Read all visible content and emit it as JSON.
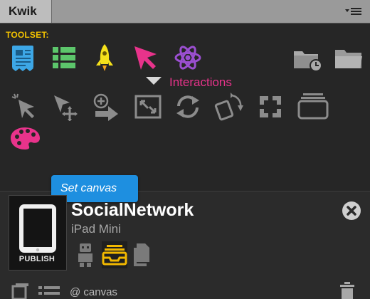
{
  "panel": {
    "tab_title": "Kwik",
    "menu_icon": "panel-menu-icon"
  },
  "toolset": {
    "label": "TOOLSET:",
    "tools": [
      {
        "name": "document-icon",
        "color": "#3da7e6"
      },
      {
        "name": "list-icon",
        "color": "#5cc66b"
      },
      {
        "name": "rocket-icon",
        "color": "#f5e11b"
      },
      {
        "name": "pointer-icon",
        "color": "#e8338b"
      },
      {
        "name": "atom-icon",
        "color": "#9b4fd1"
      }
    ],
    "folder_icons": [
      "folder-clock-icon",
      "folder-icon"
    ]
  },
  "interactions": {
    "hover_label": "Interactions",
    "hover_label_color": "#e8338b",
    "tools": [
      "select-pointer-icon",
      "move-pointer-icon",
      "add-pointer-icon",
      "resize-icon",
      "refresh-icon",
      "rotate-icon",
      "expand-icon",
      "window-icon",
      "palette-icon"
    ]
  },
  "tooltip": {
    "text": "Set canvas",
    "color": "#1e8fe0"
  },
  "project": {
    "publish_label": "PUBLISH",
    "name": "SocialNetwork",
    "device": "iPad Mini",
    "close_icon": "close-circle-icon",
    "action_icons": [
      "robot-icon",
      "tray-icon",
      "copy-icon"
    ],
    "selected_action_color": "#f2b800"
  },
  "footer": {
    "canvas_label": "@ canvas",
    "icons": [
      "pages-icon",
      "list-icon",
      "trash-icon"
    ]
  }
}
